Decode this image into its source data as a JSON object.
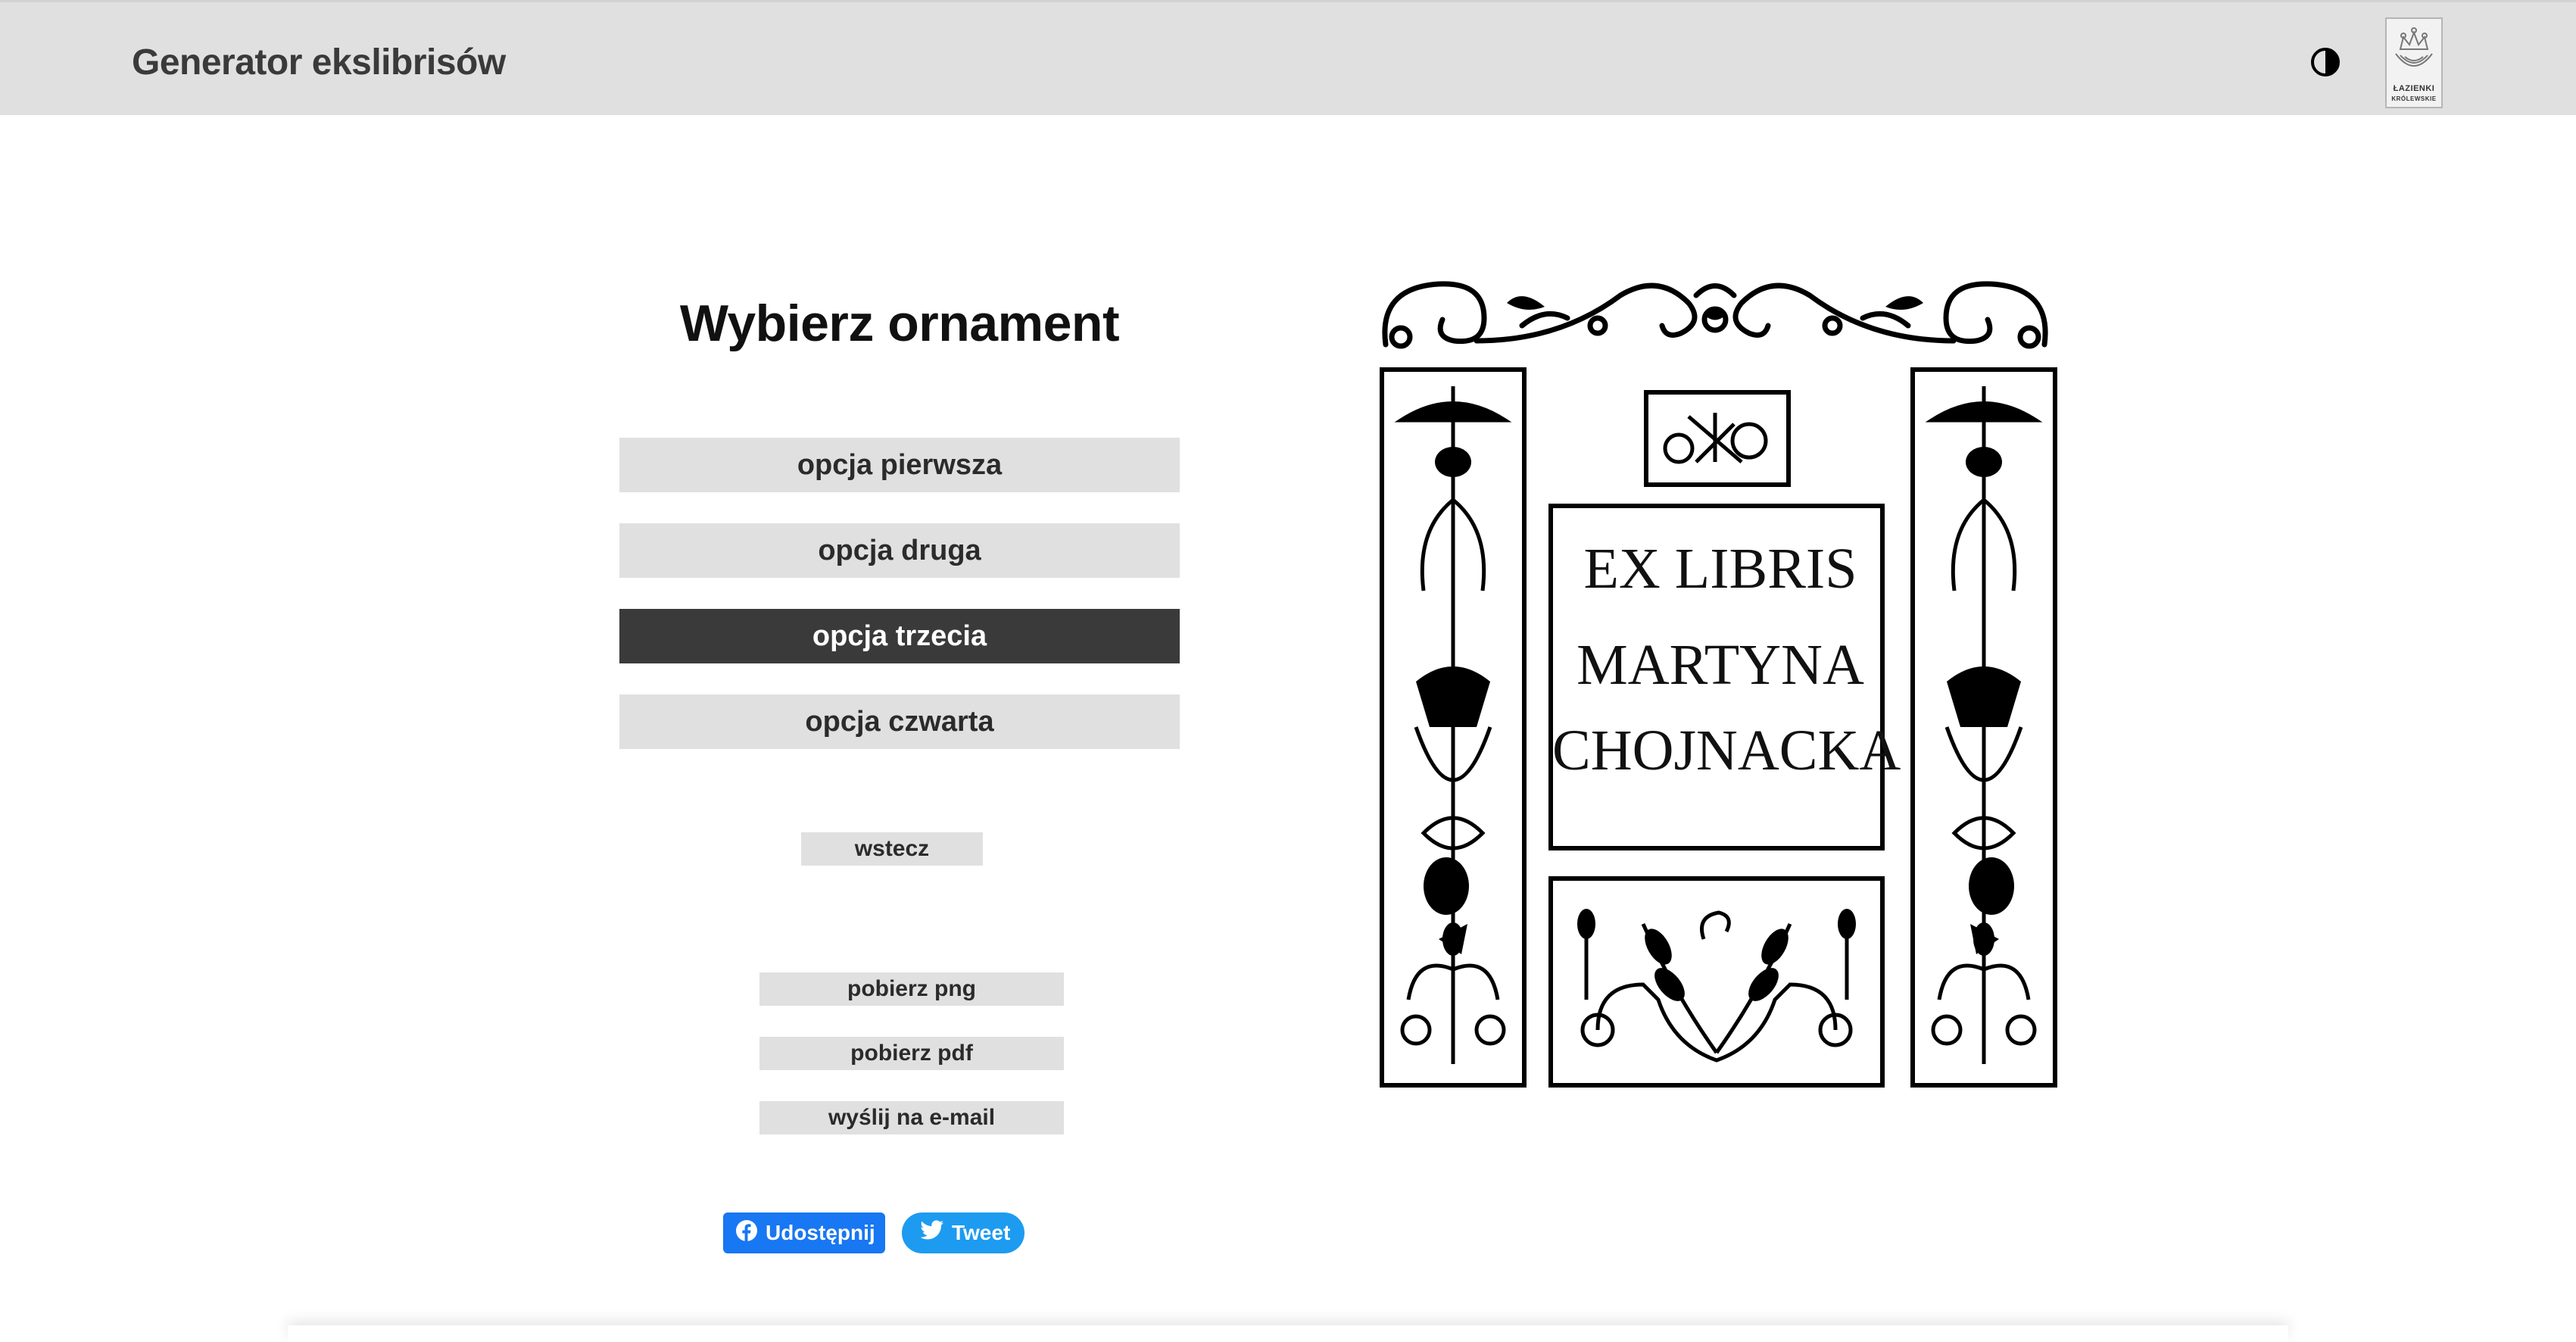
{
  "header": {
    "title": "Generator ekslibrisów",
    "contrast_icon": "contrast-icon",
    "logo": {
      "line1": "ŁAZIENKI",
      "line2": "KRÓLEWSKIE"
    }
  },
  "main": {
    "heading": "Wybierz ornament",
    "options": [
      {
        "label": "opcja pierwsza",
        "selected": false
      },
      {
        "label": "opcja druga",
        "selected": false
      },
      {
        "label": "opcja trzecia",
        "selected": true
      },
      {
        "label": "opcja czwarta",
        "selected": false
      }
    ],
    "back_label": "wstecz",
    "download_png_label": "pobierz png",
    "download_pdf_label": "pobierz pdf",
    "send_email_label": "wyślij na e-mail"
  },
  "share": {
    "facebook_label": "Udostępnij",
    "twitter_label": "Tweet",
    "facebook_color": "#1877f2",
    "twitter_color": "#1d9bf0"
  },
  "bookplate": {
    "line1": "EX LIBRIS",
    "line2": "MARTYNA",
    "line3": "CHOJNACKA"
  },
  "colors": {
    "header_bg": "#e0e0e0",
    "option_bg": "#e0e0e0",
    "option_selected_bg": "#3a3a3a"
  }
}
